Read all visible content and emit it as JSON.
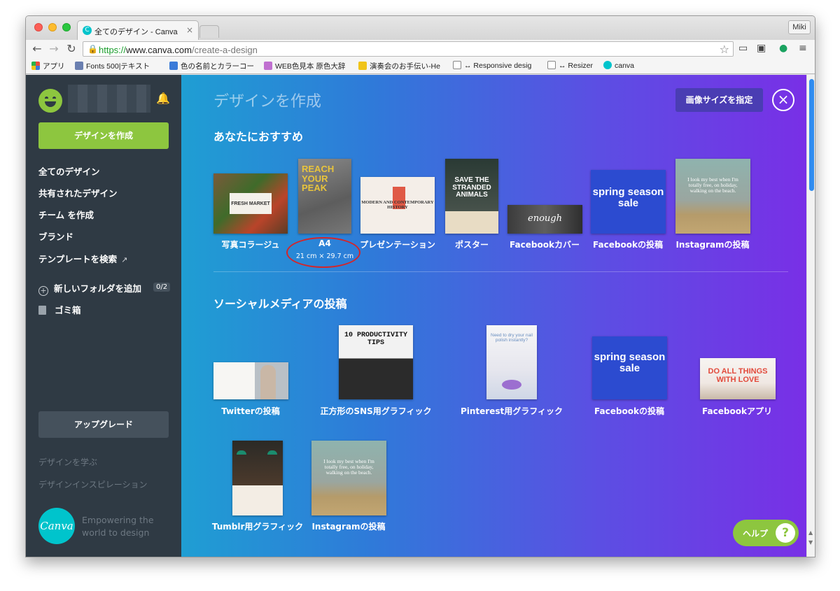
{
  "browser": {
    "tab_title": "全てのデザイン - Canva",
    "tab_close": "×",
    "tab_favicon": "C",
    "profile": "Miki",
    "url_scheme": "https://",
    "url_host": "www.canva.com",
    "url_path": "/create-a-design",
    "lock_icon": "🔒",
    "bookmarks": [
      {
        "label": "アプリ",
        "icon": "apps-grid-icon",
        "color": "#e84c3d"
      },
      {
        "label": "Fonts 500|テキスト",
        "icon": "tt-icon",
        "color": "#6a7fb0"
      },
      {
        "label": "色の名前とカラーコー",
        "icon": "free-icon",
        "color": "#3b7bd8"
      },
      {
        "label": "WEB色見本 原色大辞",
        "icon": "palette-icon",
        "color": "#c070d0"
      },
      {
        "label": "演奏会のお手伝い-He",
        "icon": "b-icon",
        "color": "#f0c419"
      },
      {
        "label": "↔ Responsive desig",
        "icon": "page-icon",
        "color": "#ffffff"
      },
      {
        "label": "↔ Resizer",
        "icon": "page-icon",
        "color": "#ffffff"
      },
      {
        "label": "canva",
        "icon": "canva-icon",
        "color": "#00c4cc"
      }
    ]
  },
  "sidebar": {
    "create_button": "デザインを作成",
    "links": [
      "全てのデザイン",
      "共有されたデザイン",
      "チーム を作成",
      "ブランド",
      "テンプレートを検索"
    ],
    "template_search_arrow": "↗",
    "add_folder": "新しいフォルダを追加",
    "folder_count": "0/2",
    "trash": "ゴミ箱",
    "upgrade": "アップグレード",
    "learn": "デザインを学ぶ",
    "inspiration": "デザインインスピレーション",
    "logo_text": "Canva",
    "tagline": "Empowering the world to design"
  },
  "main": {
    "title": "デザインを作成",
    "custom_size_button": "画像サイズを指定",
    "close": "×",
    "recommended_title": "あなたにおすすめ",
    "social_title": "ソーシャルメディアの投稿",
    "help": "ヘルプ",
    "help_icon": "?",
    "recommended": [
      {
        "label": "写真コラージュ",
        "thumb_text": "FRESH MARKET"
      },
      {
        "label": "A4",
        "sub": "21 cm × 29.7 cm",
        "thumb_text": "REACH YOUR PEAK"
      },
      {
        "label": "プレゼンテーション",
        "thumb_text": "MODERN AND CONTEMPORARY HISTORY"
      },
      {
        "label": "ポスター",
        "thumb_text": "SAVE THE STRANDED ANIMALS"
      },
      {
        "label": "Facebookカバー",
        "thumb_text": "enough"
      },
      {
        "label": "Facebookの投稿",
        "thumb_text": "spring season sale"
      },
      {
        "label": "Instagramの投稿",
        "thumb_text": "I look my best when I'm totally free, on holiday, walking on the beach."
      }
    ],
    "social": [
      {
        "label": "Twitterの投稿",
        "thumb_text": ""
      },
      {
        "label": "正方形のSNS用グラフィック",
        "thumb_text": "10 PRODUCTIVITY TIPS"
      },
      {
        "label": "Pinterest用グラフィック",
        "thumb_text": "Need to dry your nail polish instantly?"
      },
      {
        "label": "Facebookの投稿",
        "thumb_text": "spring season sale"
      },
      {
        "label": "Facebookアプリ",
        "thumb_text": "DO ALL THINGS WITH LOVE"
      },
      {
        "label": "Tumblr用グラフィック",
        "thumb_text": ""
      },
      {
        "label": "Instagramの投稿",
        "thumb_text": "I look my best when I'm totally free, on holiday, walking on the beach."
      }
    ]
  }
}
